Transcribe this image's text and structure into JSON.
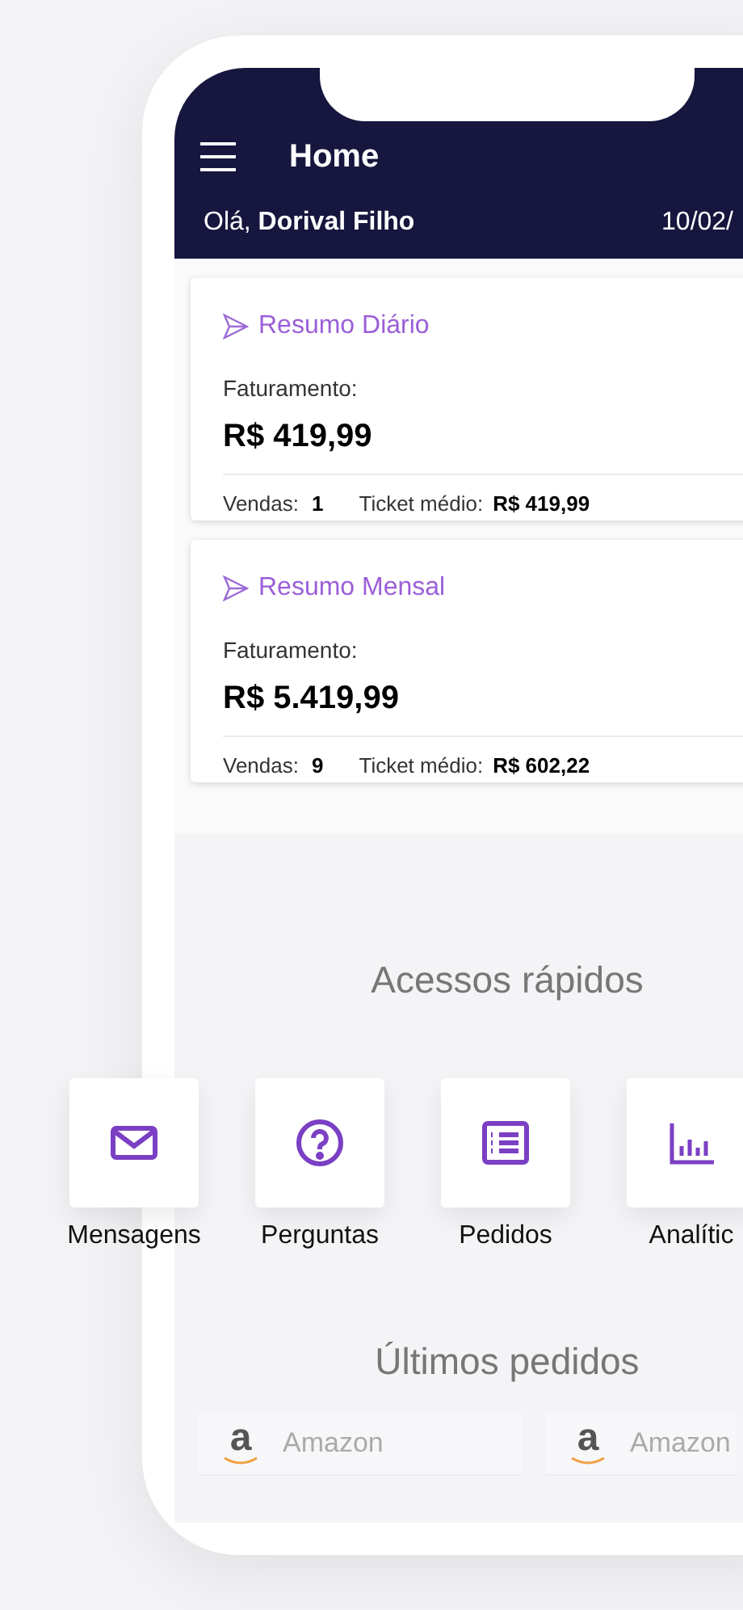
{
  "header": {
    "title": "Home",
    "greeting": "Olá,",
    "user_name": "Dorival Filho",
    "date": "10/02/"
  },
  "summaries": [
    {
      "title": "Resumo Diário",
      "label": "Faturamento:",
      "amount": "R$ 419,99",
      "sales_label": "Vendas:",
      "sales": "1",
      "ticket_label": "Ticket médio:",
      "ticket": "R$ 419,99"
    },
    {
      "title": "Resumo Mensal",
      "label": "Faturamento:",
      "amount": "R$ 5.419,99",
      "sales_label": "Vendas:",
      "sales": "9",
      "ticket_label": "Ticket médio:",
      "ticket": "R$ 602,22"
    }
  ],
  "quick_access": {
    "title": "Acessos rápidos",
    "items": [
      {
        "label": "Mensagens",
        "kind": "mail"
      },
      {
        "label": "Perguntas",
        "kind": "question"
      },
      {
        "label": "Pedidos",
        "kind": "list"
      },
      {
        "label": "Analític",
        "kind": "chart"
      }
    ]
  },
  "recent_orders": {
    "title": "Últimos pedidos",
    "items": [
      {
        "logo_letter": "a",
        "store": "Amazon"
      },
      {
        "logo_letter": "a",
        "store": "Amazon"
      }
    ]
  }
}
